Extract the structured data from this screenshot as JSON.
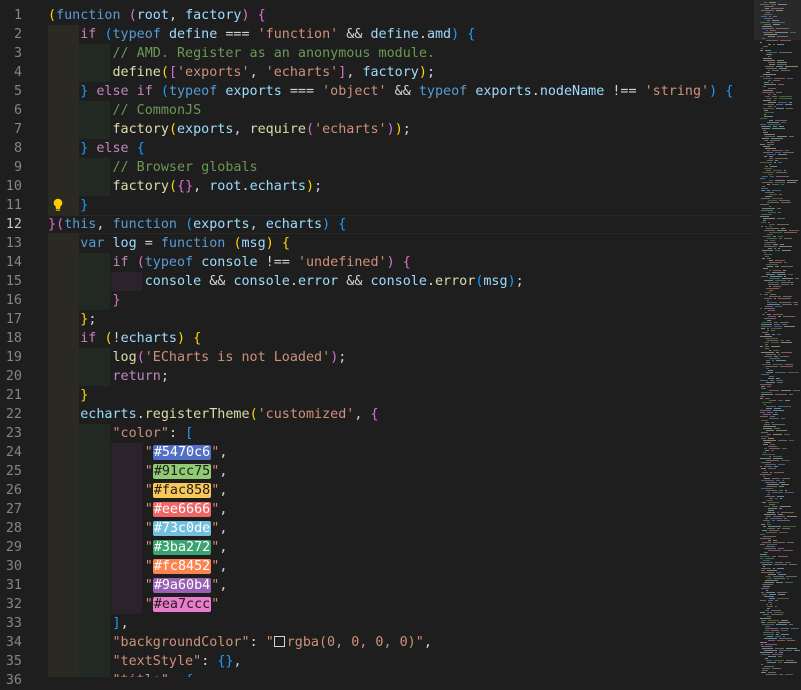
{
  "editor": {
    "language": "javascript",
    "current_line": 12,
    "lightbulb_icon": "lightbulb-icon",
    "minimap_icon": "minimap",
    "lines": [
      {
        "n": 1,
        "text": "(function (root, factory) {"
      },
      {
        "n": 2,
        "text": "    if (typeof define === 'function' && define.amd) {"
      },
      {
        "n": 3,
        "text": "        // AMD. Register as an anonymous module."
      },
      {
        "n": 4,
        "text": "        define(['exports', 'echarts'], factory);"
      },
      {
        "n": 5,
        "text": "    } else if (typeof exports === 'object' && typeof exports.nodeName !== 'string') {"
      },
      {
        "n": 6,
        "text": "        // CommonJS"
      },
      {
        "n": 7,
        "text": "        factory(exports, require('echarts'));"
      },
      {
        "n": 8,
        "text": "    } else {"
      },
      {
        "n": 9,
        "text": "        // Browser globals"
      },
      {
        "n": 10,
        "text": "        factory({}, root.echarts);"
      },
      {
        "n": 11,
        "text": "    }"
      },
      {
        "n": 12,
        "text": "}(this, function (exports, echarts) {"
      },
      {
        "n": 13,
        "text": "    var log = function (msg) {"
      },
      {
        "n": 14,
        "text": "        if (typeof console !== 'undefined') {"
      },
      {
        "n": 15,
        "text": "            console && console.error && console.error(msg);"
      },
      {
        "n": 16,
        "text": "        }"
      },
      {
        "n": 17,
        "text": "    };"
      },
      {
        "n": 18,
        "text": "    if (!echarts) {"
      },
      {
        "n": 19,
        "text": "        log('ECharts is not Loaded');"
      },
      {
        "n": 20,
        "text": "        return;"
      },
      {
        "n": 21,
        "text": "    }"
      },
      {
        "n": 22,
        "text": "    echarts.registerTheme('customized', {"
      },
      {
        "n": 23,
        "text": "        \"color\": ["
      },
      {
        "n": 24,
        "text": "            \"#5470c6\","
      },
      {
        "n": 25,
        "text": "            \"#91cc75\","
      },
      {
        "n": 26,
        "text": "            \"#fac858\","
      },
      {
        "n": 27,
        "text": "            \"#ee6666\","
      },
      {
        "n": 28,
        "text": "            \"#73c0de\","
      },
      {
        "n": 29,
        "text": "            \"#3ba272\","
      },
      {
        "n": 30,
        "text": "            \"#fc8452\","
      },
      {
        "n": 31,
        "text": "            \"#9a60b4\","
      },
      {
        "n": 32,
        "text": "            \"#ea7ccc\""
      },
      {
        "n": 33,
        "text": "        ],"
      },
      {
        "n": 34,
        "text": "        \"backgroundColor\": \"rgba(0, 0, 0, 0)\","
      },
      {
        "n": 35,
        "text": "        \"textStyle\": {},"
      },
      {
        "n": 36,
        "text": "        \"title\": {"
      }
    ],
    "swatches": [
      "#5470c6",
      "#91cc75",
      "#fac858",
      "#ee6666",
      "#73c0de",
      "#3ba272",
      "#fc8452",
      "#9a60b4",
      "#ea7ccc"
    ],
    "colors": {
      "background": "#1e1e1e",
      "keyword": "#569cd6",
      "control": "#c586c0",
      "variable": "#9cdcfe",
      "function": "#dcdcaa",
      "string": "#ce9178",
      "comment": "#6a9955",
      "line_number": "#858585",
      "bracket1": "#ffd700",
      "bracket2": "#da70d6",
      "bracket3": "#179fff"
    }
  }
}
